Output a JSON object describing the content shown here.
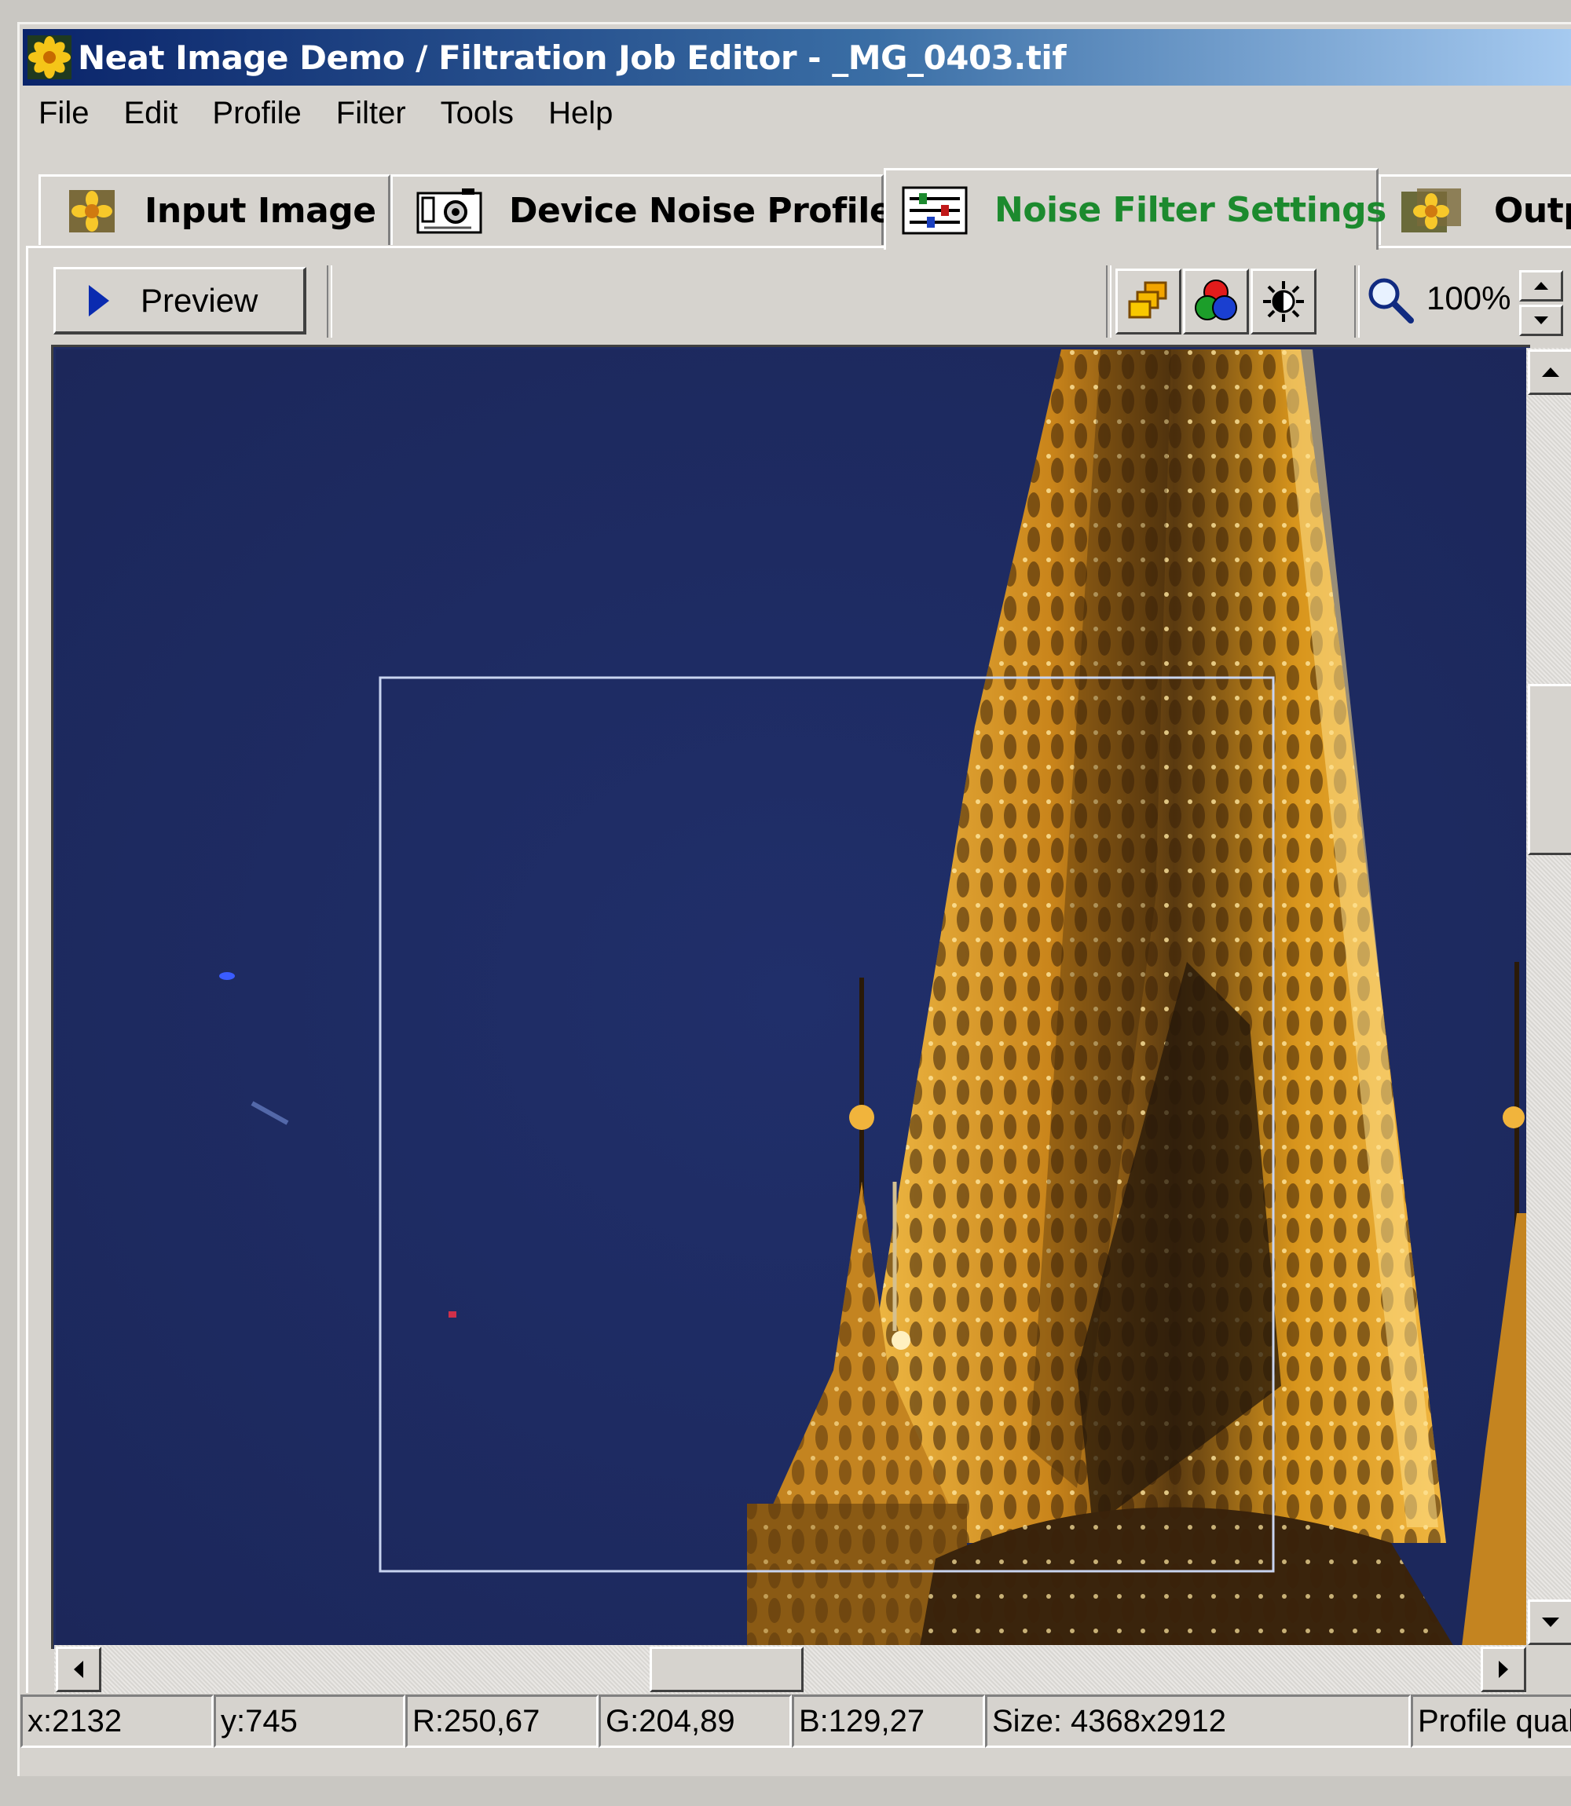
{
  "window": {
    "title": "Neat Image Demo / Filtration Job Editor - _MG_0403.tif"
  },
  "menu": {
    "items": [
      "File",
      "Edit",
      "Profile",
      "Filter",
      "Tools",
      "Help"
    ]
  },
  "tabs": [
    {
      "label": "Input Image",
      "icon": "flower-icon",
      "active": false
    },
    {
      "label": "Device Noise Profile",
      "icon": "camera-icon",
      "active": false
    },
    {
      "label": "Noise Filter Settings",
      "icon": "sliders-icon",
      "active": true
    },
    {
      "label": "Outpu",
      "icon": "flower-output-icon",
      "active": false
    }
  ],
  "toolbar": {
    "preview_label": "Preview",
    "zoom_value": "100%"
  },
  "status": {
    "x": "x:2132",
    "y": "y:745",
    "r": "R:250,67",
    "g": "G:204,89",
    "b": "B:129,27",
    "size": "Size: 4368x2912",
    "profile": "Profile quali"
  },
  "colors": {
    "title_start": "#0a246a",
    "active_tab_text": "#1c8a2e",
    "sky": "#1f2c63",
    "spire": "#d8951c"
  }
}
